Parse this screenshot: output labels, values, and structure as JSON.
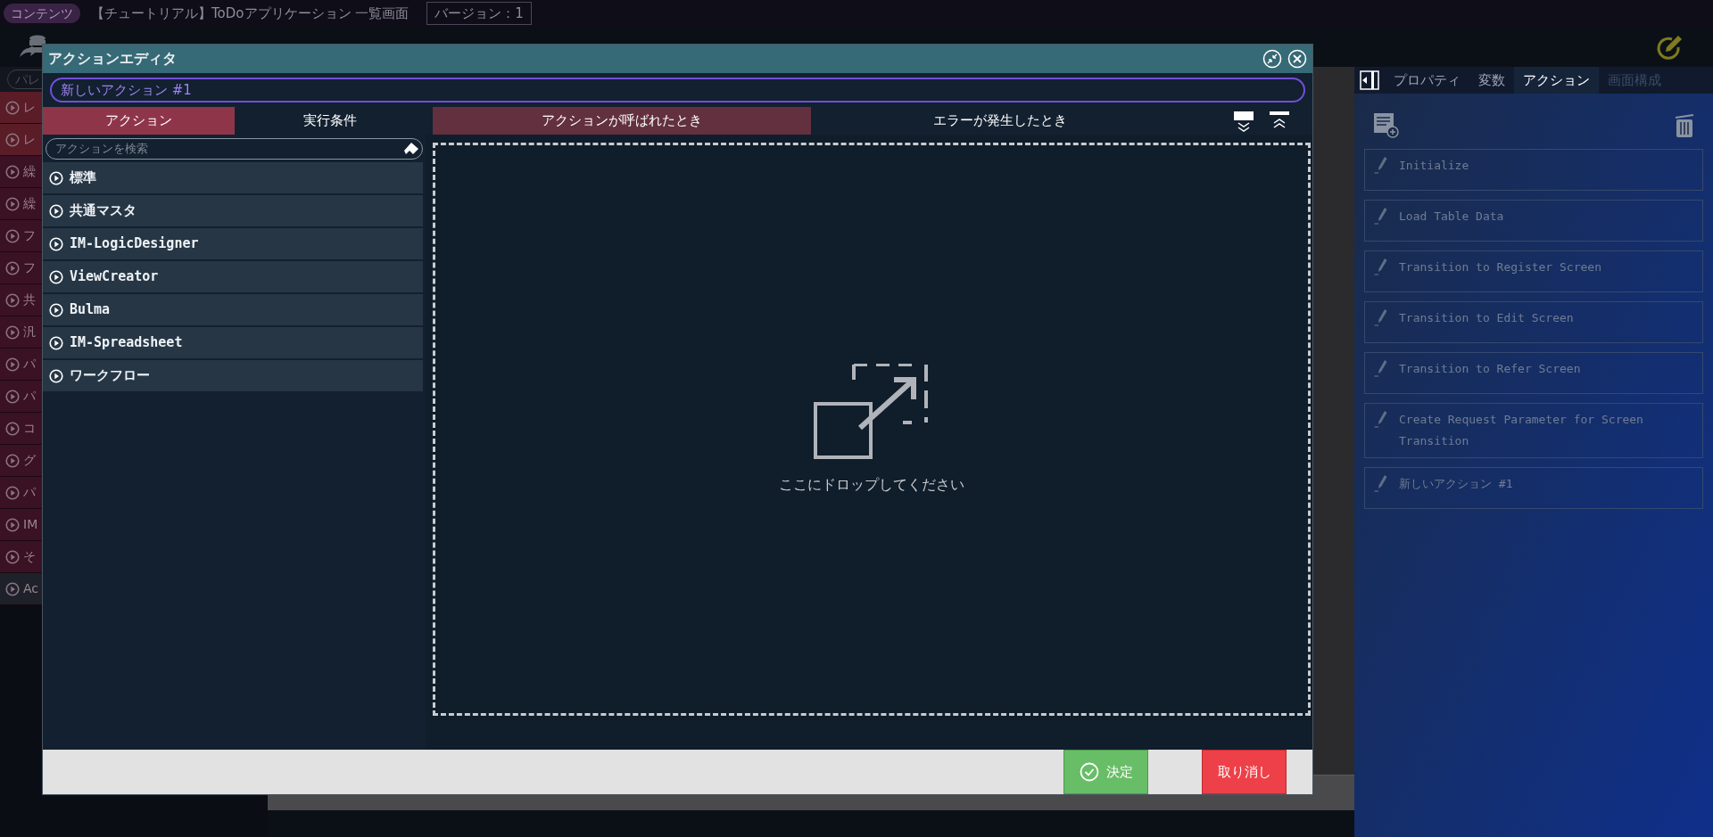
{
  "header": {
    "tag": "コンテンツ",
    "title": "【チュートリアル】ToDoアプリケーション 一覧画面",
    "version": "バージョン：1"
  },
  "palette": {
    "search": "パレ",
    "items": [
      {
        "text": "レ",
        "color": "#5a1c26"
      },
      {
        "text": "レ",
        "color": "#5a1c26"
      },
      {
        "text": "繰",
        "color": "#3b1124"
      },
      {
        "text": "繰",
        "color": "#3b1124"
      },
      {
        "text": "フ",
        "color": "#3b1124"
      },
      {
        "text": "フ",
        "color": "#3b1124"
      },
      {
        "text": "共",
        "color": "#3b1124"
      },
      {
        "text": "汎",
        "color": "#3b1124"
      },
      {
        "text": "パ",
        "color": "#3b1124"
      },
      {
        "text": "パ",
        "color": "#3b1124"
      },
      {
        "text": "コ",
        "color": "#3b1124"
      },
      {
        "text": "グ",
        "color": "#3b1124"
      },
      {
        "text": "パ",
        "color": "#3b1124"
      },
      {
        "text": "IM",
        "color": "#3b1124"
      },
      {
        "text": "そ",
        "color": "#3b1124"
      },
      {
        "text": "Ac",
        "color": "#1e2129"
      }
    ]
  },
  "dialog": {
    "title": "アクションエディタ",
    "name_value": "新しいアクション #1",
    "left_tabs": [
      {
        "label": "アクション",
        "selected": true
      },
      {
        "label": "実行条件",
        "selected": false
      }
    ],
    "right_tabs": [
      {
        "label": "アクションが呼ばれたとき",
        "selected": true
      },
      {
        "label": "エラーが発生したとき",
        "selected": false
      }
    ],
    "search_placeholder": "アクションを検索",
    "categories": [
      "標準",
      "共通マスタ",
      "IM-LogicDesigner",
      "ViewCreator",
      "Bulma",
      "IM-Spreadsheet",
      "ワークフロー"
    ],
    "drop_hint": "ここにドロップしてください",
    "buttons": [
      {
        "kind": "ok",
        "label": "決定"
      },
      {
        "kind": "cancel",
        "label": "取り消し"
      }
    ]
  },
  "right_panel": {
    "tabs": [
      {
        "label": "プロパティ",
        "selected": false,
        "disabled": false
      },
      {
        "label": "変数",
        "selected": false,
        "disabled": false
      },
      {
        "label": "アクション",
        "selected": true,
        "disabled": false
      },
      {
        "label": "画面構成",
        "selected": false,
        "disabled": true
      }
    ],
    "actions": [
      "Initialize",
      "Load Table Data",
      "Transition to Register Screen",
      "Transition to Edit Screen",
      "Transition to Refer Screen",
      "Create Request Parameter for Screen Transition",
      "新しいアクション #1"
    ]
  }
}
